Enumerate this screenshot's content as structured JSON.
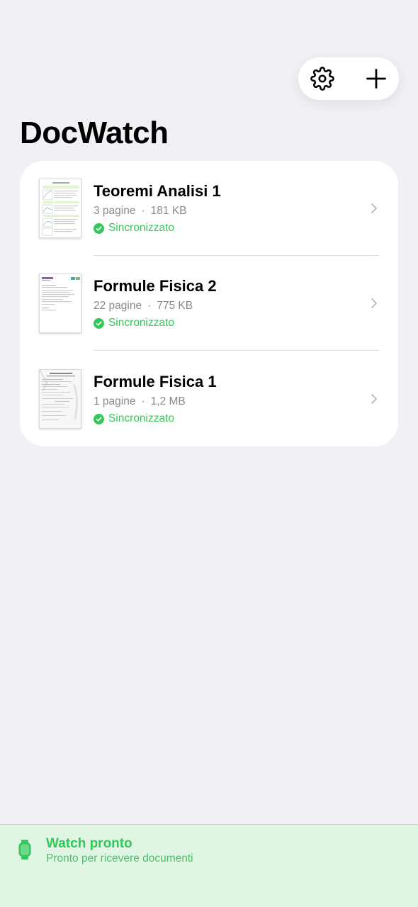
{
  "app": {
    "title": "DocWatch"
  },
  "toolbar": {
    "settings_icon": "gear-icon",
    "add_icon": "plus-icon"
  },
  "documents": [
    {
      "name": "Teoremi Analisi 1",
      "pages": "3 pagine",
      "size": "181 KB",
      "status": "Sincronizzato"
    },
    {
      "name": "Formule Fisica 2",
      "pages": "22 pagine",
      "size": "775 KB",
      "status": "Sincronizzato"
    },
    {
      "name": "Formule Fisica 1",
      "pages": "1 pagine",
      "size": "1,2 MB",
      "status": "Sincronizzato"
    }
  ],
  "meta_separator": "·",
  "watch": {
    "title": "Watch pronto",
    "subtitle": "Pronto per ricevere documenti",
    "icon": "watch-icon"
  },
  "colors": {
    "accent_green": "#34c759",
    "background": "#f0f0f5",
    "watch_bar": "#e1f5e4"
  }
}
